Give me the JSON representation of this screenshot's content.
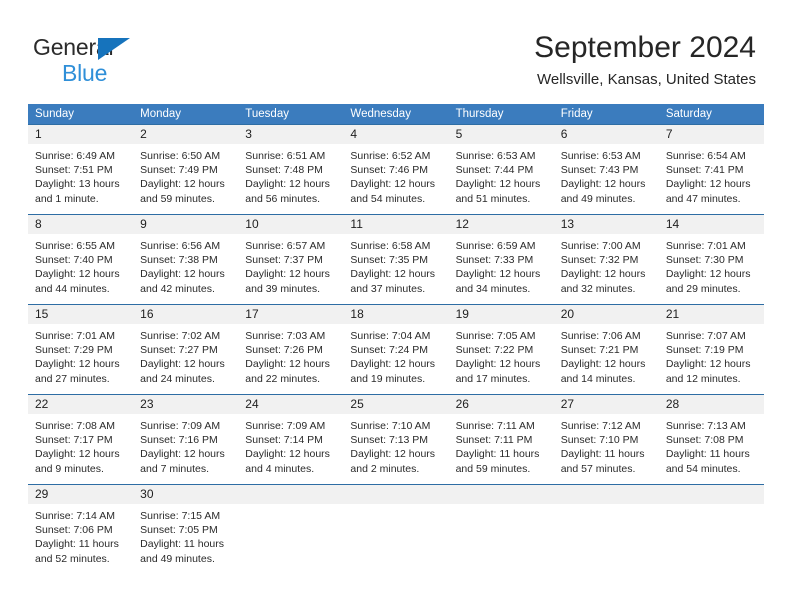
{
  "brand": {
    "name_part1": "General",
    "name_part2": "Blue",
    "logo_icon": "triangle-flag-icon"
  },
  "header": {
    "month_title": "September 2024",
    "location": "Wellsville, Kansas, United States"
  },
  "colors": {
    "header_blue": "#3b7cbe",
    "row_divider_blue": "#2e6da4",
    "daynumber_band": "#f1f1f1",
    "brand_blue": "#2f8fd8",
    "logo_blue": "#1673bc"
  },
  "weekdays": [
    "Sunday",
    "Monday",
    "Tuesday",
    "Wednesday",
    "Thursday",
    "Friday",
    "Saturday"
  ],
  "weeks": [
    {
      "numbers": [
        "1",
        "2",
        "3",
        "4",
        "5",
        "6",
        "7"
      ],
      "cells": [
        {
          "l1": "Sunrise: 6:49 AM",
          "l2": "Sunset: 7:51 PM",
          "l3": "Daylight: 13 hours",
          "l4": "and 1 minute."
        },
        {
          "l1": "Sunrise: 6:50 AM",
          "l2": "Sunset: 7:49 PM",
          "l3": "Daylight: 12 hours",
          "l4": "and 59 minutes."
        },
        {
          "l1": "Sunrise: 6:51 AM",
          "l2": "Sunset: 7:48 PM",
          "l3": "Daylight: 12 hours",
          "l4": "and 56 minutes."
        },
        {
          "l1": "Sunrise: 6:52 AM",
          "l2": "Sunset: 7:46 PM",
          "l3": "Daylight: 12 hours",
          "l4": "and 54 minutes."
        },
        {
          "l1": "Sunrise: 6:53 AM",
          "l2": "Sunset: 7:44 PM",
          "l3": "Daylight: 12 hours",
          "l4": "and 51 minutes."
        },
        {
          "l1": "Sunrise: 6:53 AM",
          "l2": "Sunset: 7:43 PM",
          "l3": "Daylight: 12 hours",
          "l4": "and 49 minutes."
        },
        {
          "l1": "Sunrise: 6:54 AM",
          "l2": "Sunset: 7:41 PM",
          "l3": "Daylight: 12 hours",
          "l4": "and 47 minutes."
        }
      ]
    },
    {
      "numbers": [
        "8",
        "9",
        "10",
        "11",
        "12",
        "13",
        "14"
      ],
      "cells": [
        {
          "l1": "Sunrise: 6:55 AM",
          "l2": "Sunset: 7:40 PM",
          "l3": "Daylight: 12 hours",
          "l4": "and 44 minutes."
        },
        {
          "l1": "Sunrise: 6:56 AM",
          "l2": "Sunset: 7:38 PM",
          "l3": "Daylight: 12 hours",
          "l4": "and 42 minutes."
        },
        {
          "l1": "Sunrise: 6:57 AM",
          "l2": "Sunset: 7:37 PM",
          "l3": "Daylight: 12 hours",
          "l4": "and 39 minutes."
        },
        {
          "l1": "Sunrise: 6:58 AM",
          "l2": "Sunset: 7:35 PM",
          "l3": "Daylight: 12 hours",
          "l4": "and 37 minutes."
        },
        {
          "l1": "Sunrise: 6:59 AM",
          "l2": "Sunset: 7:33 PM",
          "l3": "Daylight: 12 hours",
          "l4": "and 34 minutes."
        },
        {
          "l1": "Sunrise: 7:00 AM",
          "l2": "Sunset: 7:32 PM",
          "l3": "Daylight: 12 hours",
          "l4": "and 32 minutes."
        },
        {
          "l1": "Sunrise: 7:01 AM",
          "l2": "Sunset: 7:30 PM",
          "l3": "Daylight: 12 hours",
          "l4": "and 29 minutes."
        }
      ]
    },
    {
      "numbers": [
        "15",
        "16",
        "17",
        "18",
        "19",
        "20",
        "21"
      ],
      "cells": [
        {
          "l1": "Sunrise: 7:01 AM",
          "l2": "Sunset: 7:29 PM",
          "l3": "Daylight: 12 hours",
          "l4": "and 27 minutes."
        },
        {
          "l1": "Sunrise: 7:02 AM",
          "l2": "Sunset: 7:27 PM",
          "l3": "Daylight: 12 hours",
          "l4": "and 24 minutes."
        },
        {
          "l1": "Sunrise: 7:03 AM",
          "l2": "Sunset: 7:26 PM",
          "l3": "Daylight: 12 hours",
          "l4": "and 22 minutes."
        },
        {
          "l1": "Sunrise: 7:04 AM",
          "l2": "Sunset: 7:24 PM",
          "l3": "Daylight: 12 hours",
          "l4": "and 19 minutes."
        },
        {
          "l1": "Sunrise: 7:05 AM",
          "l2": "Sunset: 7:22 PM",
          "l3": "Daylight: 12 hours",
          "l4": "and 17 minutes."
        },
        {
          "l1": "Sunrise: 7:06 AM",
          "l2": "Sunset: 7:21 PM",
          "l3": "Daylight: 12 hours",
          "l4": "and 14 minutes."
        },
        {
          "l1": "Sunrise: 7:07 AM",
          "l2": "Sunset: 7:19 PM",
          "l3": "Daylight: 12 hours",
          "l4": "and 12 minutes."
        }
      ]
    },
    {
      "numbers": [
        "22",
        "23",
        "24",
        "25",
        "26",
        "27",
        "28"
      ],
      "cells": [
        {
          "l1": "Sunrise: 7:08 AM",
          "l2": "Sunset: 7:17 PM",
          "l3": "Daylight: 12 hours",
          "l4": "and 9 minutes."
        },
        {
          "l1": "Sunrise: 7:09 AM",
          "l2": "Sunset: 7:16 PM",
          "l3": "Daylight: 12 hours",
          "l4": "and 7 minutes."
        },
        {
          "l1": "Sunrise: 7:09 AM",
          "l2": "Sunset: 7:14 PM",
          "l3": "Daylight: 12 hours",
          "l4": "and 4 minutes."
        },
        {
          "l1": "Sunrise: 7:10 AM",
          "l2": "Sunset: 7:13 PM",
          "l3": "Daylight: 12 hours",
          "l4": "and 2 minutes."
        },
        {
          "l1": "Sunrise: 7:11 AM",
          "l2": "Sunset: 7:11 PM",
          "l3": "Daylight: 11 hours",
          "l4": "and 59 minutes."
        },
        {
          "l1": "Sunrise: 7:12 AM",
          "l2": "Sunset: 7:10 PM",
          "l3": "Daylight: 11 hours",
          "l4": "and 57 minutes."
        },
        {
          "l1": "Sunrise: 7:13 AM",
          "l2": "Sunset: 7:08 PM",
          "l3": "Daylight: 11 hours",
          "l4": "and 54 minutes."
        }
      ]
    },
    {
      "numbers": [
        "29",
        "30",
        "",
        "",
        "",
        "",
        ""
      ],
      "cells": [
        {
          "l1": "Sunrise: 7:14 AM",
          "l2": "Sunset: 7:06 PM",
          "l3": "Daylight: 11 hours",
          "l4": "and 52 minutes."
        },
        {
          "l1": "Sunrise: 7:15 AM",
          "l2": "Sunset: 7:05 PM",
          "l3": "Daylight: 11 hours",
          "l4": "and 49 minutes."
        },
        {
          "l1": "",
          "l2": "",
          "l3": "",
          "l4": ""
        },
        {
          "l1": "",
          "l2": "",
          "l3": "",
          "l4": ""
        },
        {
          "l1": "",
          "l2": "",
          "l3": "",
          "l4": ""
        },
        {
          "l1": "",
          "l2": "",
          "l3": "",
          "l4": ""
        },
        {
          "l1": "",
          "l2": "",
          "l3": "",
          "l4": ""
        }
      ]
    }
  ]
}
